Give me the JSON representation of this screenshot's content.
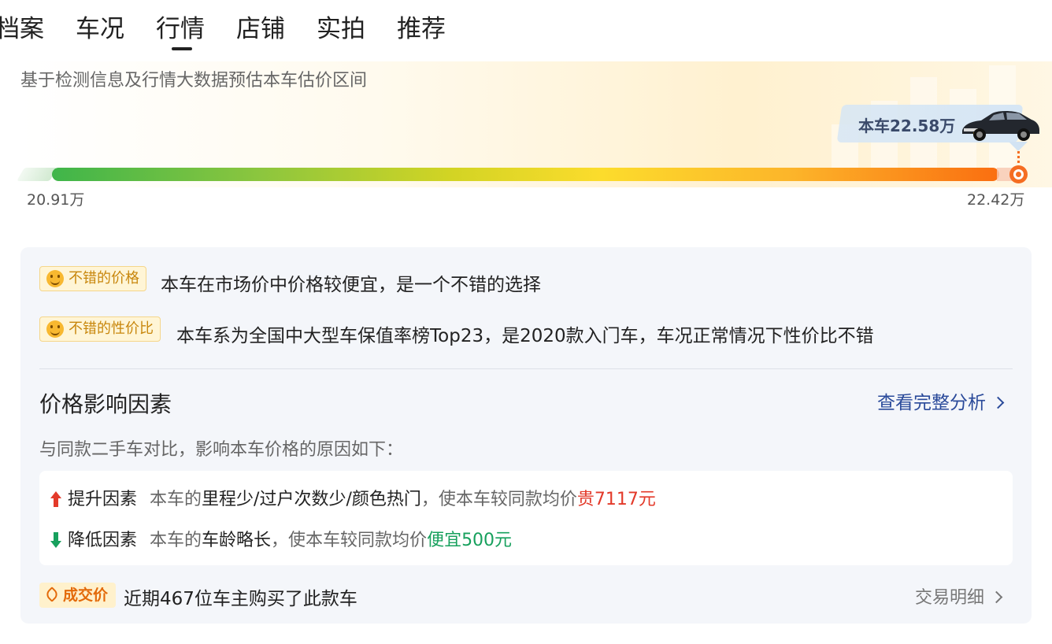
{
  "tabs": [
    {
      "label": "档案"
    },
    {
      "label": "车况"
    },
    {
      "label": "行情",
      "active": true
    },
    {
      "label": "店铺"
    },
    {
      "label": "实拍"
    },
    {
      "label": "推荐"
    }
  ],
  "valuation": {
    "subtitle": "基于检测信息及行情大数据预估本车估价区间",
    "car_price_label": "本车22.58万",
    "range_min": "20.91万",
    "range_max": "22.42万",
    "car_position_fraction": 1.0
  },
  "badges": [
    {
      "tag": "不错的价格",
      "text": "本车在市场价中价格较便宜，是一个不错的选择",
      "icon": "smile-icon"
    },
    {
      "tag": "不错的性价比",
      "text": "本车系为全国中大型车保值率榜Top23，是2020款入门车，车况正常情况下性价比不错",
      "icon": "smile-icon"
    }
  ],
  "factors_section": {
    "title": "价格影响因素",
    "link_label": "查看完整分析",
    "description": "与同款二手车对比，影响本车价格的原因如下："
  },
  "factors": {
    "up": {
      "name": "提升因素",
      "prefix": "本车的",
      "items": "里程少/过户次数少/颜色热门",
      "middle": "，使本车较同款均价",
      "effect": "贵7117元"
    },
    "down": {
      "name": "降低因素",
      "prefix": "本车的",
      "items": "车龄略长",
      "middle": "，使本车较同款均价",
      "effect": "便宜500元"
    }
  },
  "deal": {
    "tag": "成交价",
    "text": "近期467位车主购买了此款车",
    "link_label": "交易明细"
  },
  "colors": {
    "accent_orange": "#f56d22",
    "up_red": "#e33a2a",
    "down_green": "#17a05d",
    "link_blue": "#2a4a9a"
  }
}
